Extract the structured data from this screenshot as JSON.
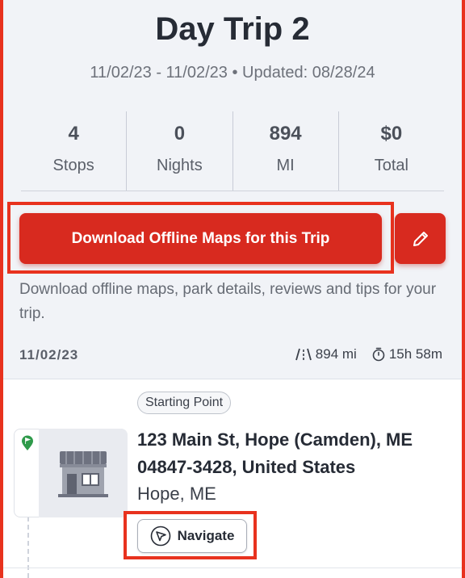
{
  "trip": {
    "title": "Day Trip 2",
    "dates": "11/02/23 - 11/02/23 • Updated: 08/28/24"
  },
  "stats": [
    {
      "value": "4",
      "label": "Stops"
    },
    {
      "value": "0",
      "label": "Nights"
    },
    {
      "value": "894",
      "label": "MI"
    },
    {
      "value": "$0",
      "label": "Total"
    }
  ],
  "download": {
    "button_label": "Download Offline Maps for this Trip",
    "description": "Download offline maps, park details, reviews and tips for your trip."
  },
  "day": {
    "date": "11/02/23",
    "distance": "894 mi",
    "duration": "15h 58m"
  },
  "stop": {
    "badge": "Starting Point",
    "address": "123 Main St, Hope (Camden), ME 04847-3428, United States",
    "city": "Hope, ME",
    "navigate_label": "Navigate"
  },
  "colors": {
    "accent": "#d82a1f",
    "highlight_outline": "#e8321e",
    "pin_green": "#2e9a4a"
  },
  "icons": [
    "pencil-icon",
    "road-icon",
    "stopwatch-icon",
    "location-pin-icon",
    "store-icon",
    "navigation-arrow-icon"
  ]
}
